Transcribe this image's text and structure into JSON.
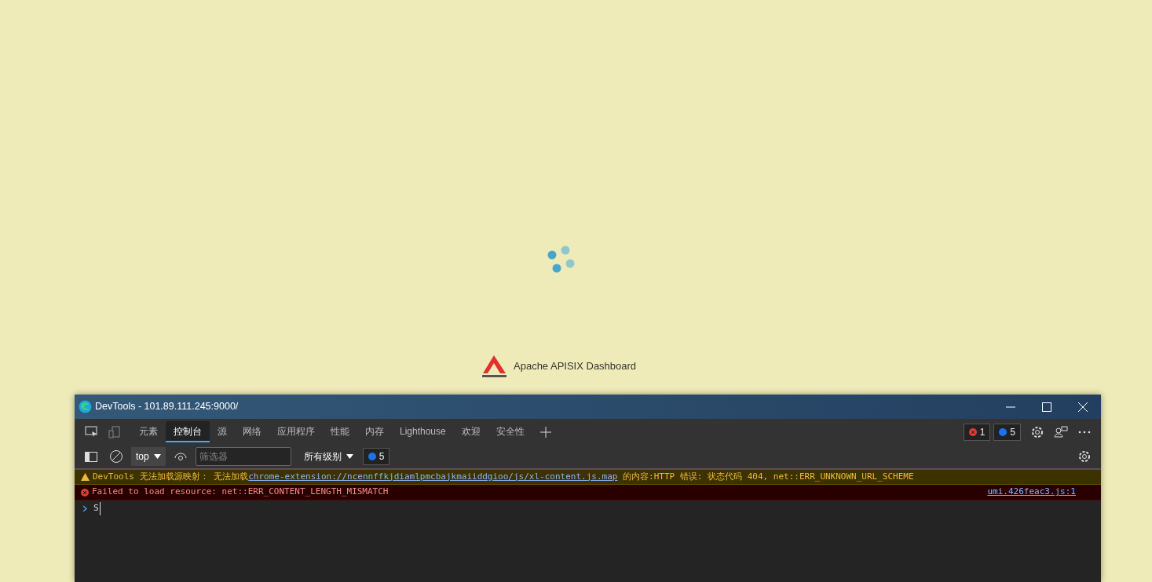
{
  "page": {
    "brand": "Apache APISIX Dashboard"
  },
  "devtools": {
    "title": "DevTools - 101.89.111.245:9000/",
    "tabs": [
      {
        "label": "元素",
        "selected": false
      },
      {
        "label": "控制台",
        "selected": true
      },
      {
        "label": "源",
        "selected": false
      },
      {
        "label": "网络",
        "selected": false
      },
      {
        "label": "应用程序",
        "selected": false
      },
      {
        "label": "性能",
        "selected": false
      },
      {
        "label": "内存",
        "selected": false
      },
      {
        "label": "Lighthouse",
        "selected": false
      },
      {
        "label": "欢迎",
        "selected": false
      },
      {
        "label": "安全性",
        "selected": false
      }
    ],
    "error_count": "1",
    "message_count": "5",
    "toolbar": {
      "context": "top",
      "filter_placeholder": "筛选器",
      "levels": "所有级别",
      "issues": "5"
    },
    "messages": [
      {
        "kind": "warning",
        "text": "DevTools 无法加载源映射： 无法加载",
        "link": "chrome-extension://ncennffkjdiamlpmcbajkmaiiddgioo/js/xl-content.js.map",
        "text_after": " 的内容:HTTP 错误: 状态代码 404, net::ERR_UNKNOWN_URL_SCHEME"
      },
      {
        "kind": "error",
        "text": "Failed to load resource: net::ERR_CONTENT_LENGTH_MISMATCH",
        "source": "umi.426feac3.js:1"
      }
    ],
    "prompt": "S"
  }
}
